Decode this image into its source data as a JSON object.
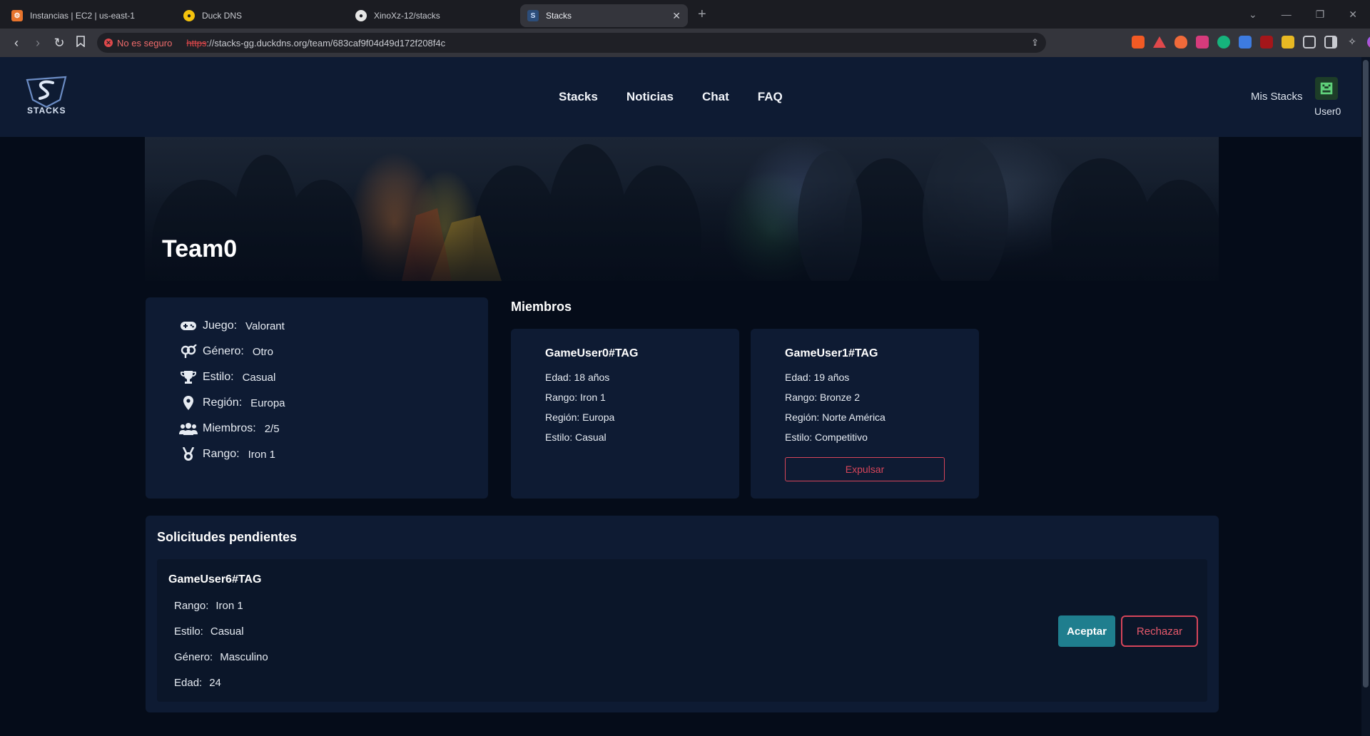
{
  "browser": {
    "tabs": [
      {
        "title": "Instancias | EC2 | us-east-1",
        "icon": "aws-icon",
        "active": false
      },
      {
        "title": "Duck DNS",
        "icon": "duck-icon",
        "active": false
      },
      {
        "title": "XinoXz-12/stacks",
        "icon": "github-icon",
        "active": false
      },
      {
        "title": "Stacks",
        "icon": "stacks-icon",
        "active": true
      }
    ],
    "insecure_label": "No es seguro",
    "url_scheme": "https",
    "url_rest": "://stacks-gg.duckdns.org/team/683caf9f04d49d172f208f4c"
  },
  "site": {
    "logo_text": "STACKS",
    "nav": [
      "Stacks",
      "Noticias",
      "Chat",
      "FAQ"
    ],
    "my_stacks": "Mis Stacks",
    "username": "User0"
  },
  "team": {
    "name": "Team0",
    "info": [
      {
        "label": "Juego:",
        "value": "Valorant",
        "icon": "gamepad-icon"
      },
      {
        "label": "Género:",
        "value": "Otro",
        "icon": "gender-icon"
      },
      {
        "label": "Estilo:",
        "value": "Casual",
        "icon": "trophy-icon"
      },
      {
        "label": "Región:",
        "value": "Europa",
        "icon": "location-pin-icon"
      },
      {
        "label": "Miembros:",
        "value": "2/5",
        "icon": "users-icon"
      },
      {
        "label": "Rango:",
        "value": "Iron 1",
        "icon": "medal-icon"
      }
    ]
  },
  "members": {
    "title": "Miembros",
    "list": [
      {
        "name": "GameUser0#TAG",
        "edad": "Edad: 18 años",
        "rango": "Rango: Iron 1",
        "region": "Región: Europa",
        "estilo": "Estilo: Casual"
      },
      {
        "name": "GameUser1#TAG",
        "edad": "Edad: 19 años",
        "rango": "Rango: Bronze 2",
        "region": "Región: Norte América",
        "estilo": "Estilo: Competitivo",
        "expel_label": "Expulsar"
      }
    ]
  },
  "pending": {
    "title": "Solicitudes pendientes",
    "request": {
      "name": "GameUser6#TAG",
      "rango_label": "Rango:",
      "rango": "Iron 1",
      "estilo_label": "Estilo:",
      "estilo": "Casual",
      "genero_label": "Género:",
      "genero": "Masculino",
      "edad_label": "Edad:",
      "edad": "24",
      "accept_label": "Aceptar",
      "reject_label": "Rechazar"
    }
  },
  "colors": {
    "nav_bg": "#0e1b33",
    "page_bg": "#050c19",
    "accept": "#1f7e8e",
    "danger": "#d6455a"
  }
}
